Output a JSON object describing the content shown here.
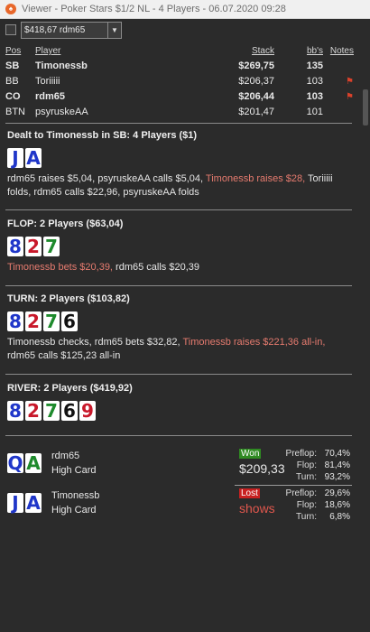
{
  "window": {
    "title": "Viewer - Poker Stars $1/2 NL - 4 Players - 06.07.2020 09:28"
  },
  "toolbar": {
    "selector_value": "$418,67 rdm65"
  },
  "players": {
    "headers": {
      "pos": "Pos",
      "player": "Player",
      "stack": "Stack",
      "bbs": "bb's",
      "notes": "Notes"
    },
    "rows": [
      {
        "pos": "SB",
        "name": "Timonessb",
        "stack": "$269,75",
        "bbs": "135",
        "bold": true,
        "flag": false
      },
      {
        "pos": "BB",
        "name": "Toriiiii",
        "stack": "$206,37",
        "bbs": "103",
        "bold": false,
        "flag": true
      },
      {
        "pos": "CO",
        "name": "rdm65",
        "stack": "$206,44",
        "bbs": "103",
        "bold": true,
        "flag": true
      },
      {
        "pos": "BTN",
        "name": "psyruskeAA",
        "stack": "$201,47",
        "bbs": "101",
        "bold": false,
        "flag": false
      }
    ]
  },
  "preflop": {
    "title": "Dealt to Timonessb in SB: 4 Players ($1)",
    "cards": [
      {
        "rank": "J",
        "suit": "d"
      },
      {
        "rank": "A",
        "suit": "d"
      }
    ],
    "actions_1": "rdm65 raises $5,04, psyruskeAA calls $5,04, ",
    "actions_hl": "Timonessb raises $28,",
    "actions_2": " Toriiiii folds, rdm65 calls $22,96, psyruskeAA folds"
  },
  "flop": {
    "title": "FLOP: 2 Players ($63,04)",
    "cards": [
      {
        "rank": "8",
        "suit": "d"
      },
      {
        "rank": "2",
        "suit": "h"
      },
      {
        "rank": "7",
        "suit": "c"
      }
    ],
    "actions_hl": "Timonessb bets $20,39,",
    "actions_2": " rdm65 calls $20,39"
  },
  "turn": {
    "title": "TURN: 2 Players ($103,82)",
    "cards": [
      {
        "rank": "8",
        "suit": "d"
      },
      {
        "rank": "2",
        "suit": "h"
      },
      {
        "rank": "7",
        "suit": "c"
      },
      {
        "rank": "6",
        "suit": "s"
      }
    ],
    "actions_1": "Timonessb checks, rdm65 bets $32,82, ",
    "actions_hl": "Timonessb raises $221,36 all-in,",
    "actions_2": " rdm65 calls $125,23 all-in"
  },
  "river": {
    "title": "RIVER: 2 Players ($419,92)",
    "cards": [
      {
        "rank": "8",
        "suit": "d"
      },
      {
        "rank": "2",
        "suit": "h"
      },
      {
        "rank": "7",
        "suit": "c"
      },
      {
        "rank": "6",
        "suit": "s"
      },
      {
        "rank": "9",
        "suit": "h"
      }
    ]
  },
  "results": [
    {
      "name": "rdm65",
      "hand": "High Card",
      "status": "Won",
      "amount": "$209,33",
      "won": true,
      "cards": [
        {
          "rank": "Q",
          "suit": "d"
        },
        {
          "rank": "A",
          "suit": "c"
        }
      ],
      "stats": [
        {
          "label": "Preflop:",
          "value": "70,4%"
        },
        {
          "label": "Flop:",
          "value": "81,4%"
        },
        {
          "label": "Turn:",
          "value": "93,2%"
        }
      ]
    },
    {
      "name": "Timonessb",
      "hand": "High Card",
      "status": "Lost",
      "amount": "shows",
      "won": false,
      "cards": [
        {
          "rank": "J",
          "suit": "d"
        },
        {
          "rank": "A",
          "suit": "d"
        }
      ],
      "stats": [
        {
          "label": "Preflop:",
          "value": "29,6%"
        },
        {
          "label": "Flop:",
          "value": "18,6%"
        },
        {
          "label": "Turn:",
          "value": "6,8%"
        }
      ]
    }
  ],
  "colors": {
    "accent": "#e67b6f",
    "won": "#2f8a22",
    "lost": "#c82121",
    "background": "#2b2b2b"
  }
}
